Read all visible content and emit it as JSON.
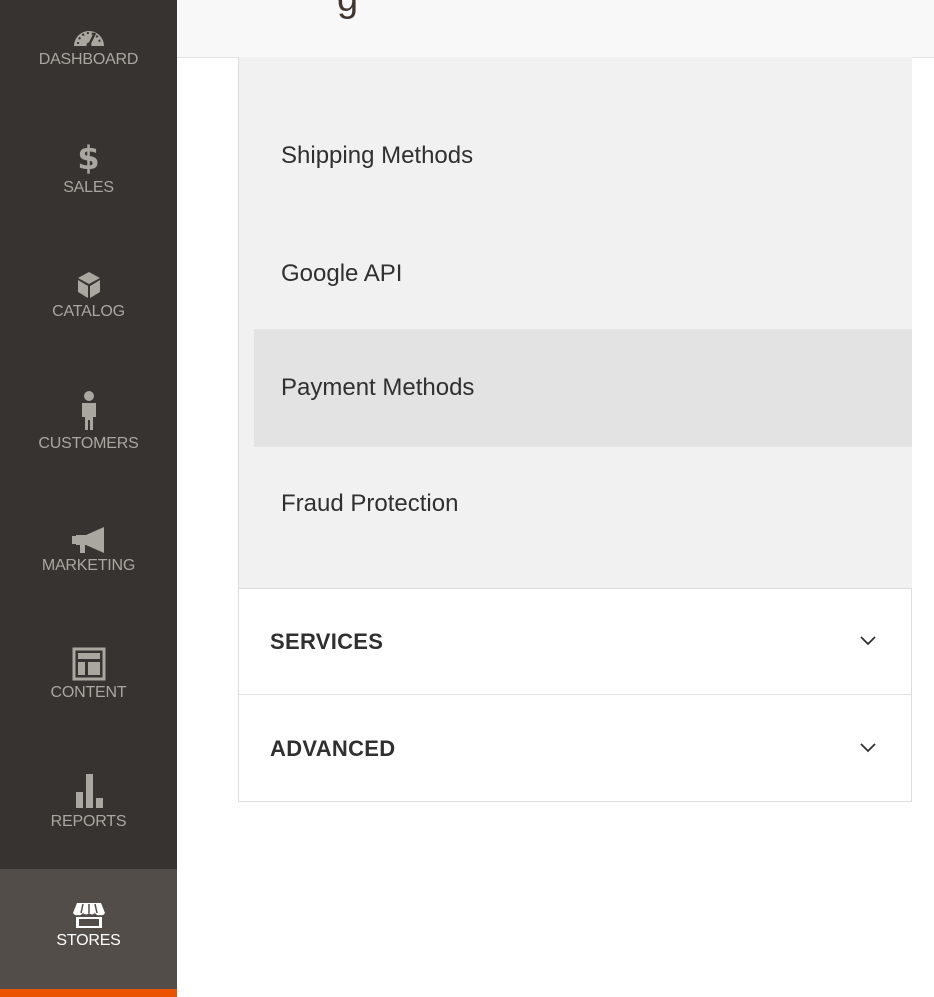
{
  "header": {
    "title_fragment": "g"
  },
  "nav": {
    "items": [
      {
        "label": "DASHBOARD",
        "icon": "dashboard-icon"
      },
      {
        "label": "SALES",
        "icon": "dollar-icon"
      },
      {
        "label": "CATALOG",
        "icon": "box-icon"
      },
      {
        "label": "CUSTOMERS",
        "icon": "person-icon"
      },
      {
        "label": "MARKETING",
        "icon": "megaphone-icon"
      },
      {
        "label": "CONTENT",
        "icon": "layout-icon"
      },
      {
        "label": "REPORTS",
        "icon": "bar-chart-icon"
      },
      {
        "label": "STORES",
        "icon": "storefront-icon",
        "active": true
      }
    ],
    "accent_color": "#eb5202"
  },
  "config_tabs": {
    "sales_items": [
      {
        "label": "Shipping Methods"
      },
      {
        "label": "Google API"
      },
      {
        "label": "Payment Methods",
        "active": true
      },
      {
        "label": "Fraud Protection"
      }
    ],
    "sections": [
      {
        "title": "SERVICES",
        "icon": "chevron-down-icon"
      },
      {
        "title": "ADVANCED",
        "icon": "chevron-down-icon"
      }
    ]
  }
}
